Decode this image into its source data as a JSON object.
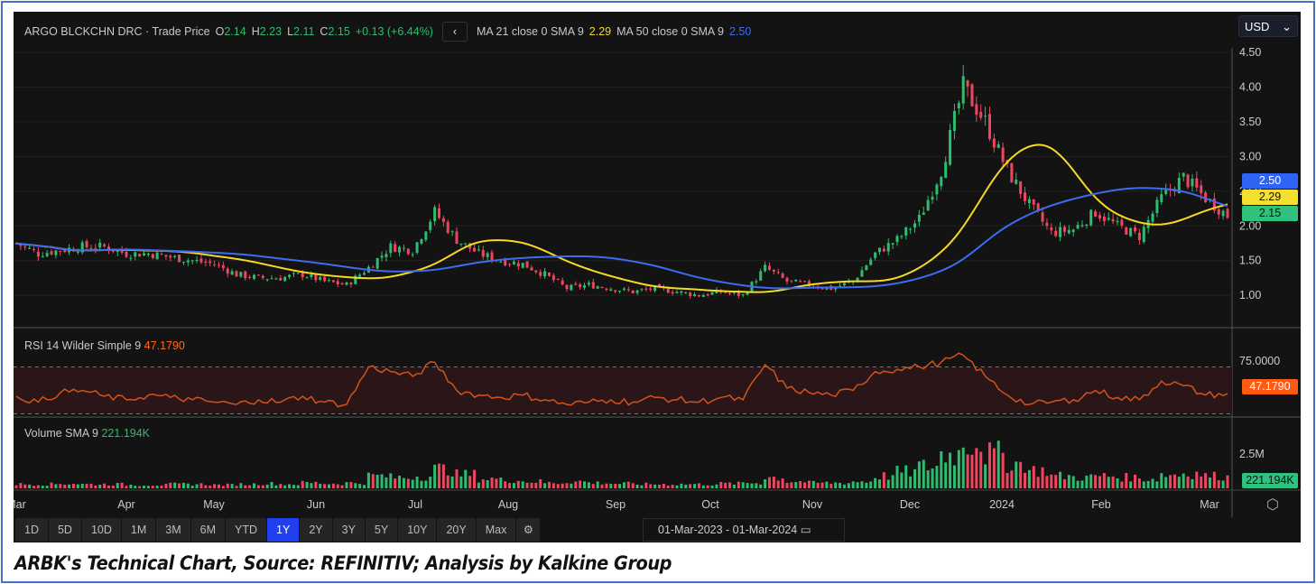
{
  "header": {
    "instrument": "ARGO BLCKCHN DRC · Trade Price",
    "o_label": "O",
    "open": "2.14",
    "h_label": "H",
    "high": "2.23",
    "l_label": "L",
    "low": "2.11",
    "c_label": "C",
    "close": "2.15",
    "change": "+0.13 (+6.44%)",
    "ma21_label": "MA 21 close 0 SMA 9",
    "ma21_value": "2.29",
    "ma50_label": "MA 50 close 0 SMA 9",
    "ma50_value": "2.50"
  },
  "currency": "USD",
  "price_axis": [
    "4.50",
    "4.00",
    "3.50",
    "3.00",
    "2.50",
    "2.00",
    "1.50",
    "1.00"
  ],
  "price_tags": {
    "ma50": "2.50",
    "ma21": "2.29",
    "close": "2.15"
  },
  "rsi": {
    "label": "RSI 14 Wilder Simple 9",
    "value": "47.1790",
    "axis": "75.0000"
  },
  "volume": {
    "label": "Volume SMA 9",
    "value": "221.194K",
    "axis": "2.5M"
  },
  "x_axis": [
    "Mar",
    "Apr",
    "May",
    "Jun",
    "Jul",
    "Aug",
    "Sep",
    "Oct",
    "Nov",
    "Dec",
    "2024",
    "Feb",
    "Mar"
  ],
  "ranges": [
    "1D",
    "5D",
    "10D",
    "1M",
    "3M",
    "6M",
    "YTD",
    "1Y",
    "2Y",
    "3Y",
    "5Y",
    "10Y",
    "20Y",
    "Max"
  ],
  "active_range": "1Y",
  "date_range": "01-Mar-2023  -  01-Mar-2024",
  "caption": "ARBK's Technical Chart, Source: REFINITIV; Analysis by Kalkine Group",
  "colors": {
    "up": "#2ebd6e",
    "down": "#f0455f",
    "ma21": "#f5d922",
    "ma50": "#3d6cf0",
    "rsi": "#d4521a"
  },
  "chart_data": {
    "type": "candlestick",
    "title": "ARGO BLCKCHN DRC - Trade Price",
    "ylim": [
      0.7,
      4.7
    ],
    "weekly_close": [
      1.75,
      1.6,
      1.65,
      1.7,
      1.7,
      1.6,
      1.6,
      1.55,
      1.5,
      1.45,
      1.3,
      1.25,
      1.25,
      1.3,
      1.2,
      1.15,
      1.4,
      1.7,
      1.65,
      2.2,
      1.8,
      1.6,
      1.5,
      1.45,
      1.3,
      1.1,
      1.15,
      1.1,
      1.05,
      1.1,
      1.05,
      1.0,
      1.05,
      1.0,
      1.4,
      1.2,
      1.15,
      1.1,
      1.2,
      1.6,
      1.8,
      2.1,
      2.8,
      4.0,
      3.5,
      2.8,
      2.3,
      1.9,
      1.95,
      2.2,
      2.0,
      1.85,
      2.4,
      2.7,
      2.4,
      2.15
    ],
    "weekly_volume_m": [
      0.3,
      0.3,
      0.35,
      0.3,
      0.3,
      0.25,
      0.25,
      0.3,
      0.3,
      0.25,
      0.3,
      0.35,
      0.3,
      0.4,
      0.35,
      0.4,
      0.9,
      0.8,
      0.9,
      1.4,
      1.0,
      0.7,
      0.6,
      0.5,
      0.4,
      0.5,
      0.4,
      0.35,
      0.3,
      0.3,
      0.3,
      0.3,
      0.35,
      0.4,
      0.8,
      0.5,
      0.4,
      0.4,
      0.5,
      0.9,
      1.2,
      1.6,
      2.5,
      3.4,
      2.5,
      1.8,
      1.3,
      0.9,
      0.8,
      0.9,
      0.8,
      0.7,
      1.0,
      1.1,
      0.9,
      0.8
    ],
    "weekly_rsi": [
      45,
      40,
      48,
      50,
      45,
      42,
      46,
      44,
      42,
      40,
      38,
      42,
      40,
      45,
      40,
      38,
      70,
      66,
      62,
      74,
      50,
      46,
      44,
      46,
      42,
      38,
      40,
      42,
      40,
      44,
      42,
      40,
      44,
      42,
      72,
      52,
      48,
      46,
      50,
      66,
      68,
      70,
      74,
      80,
      62,
      46,
      38,
      40,
      42,
      50,
      44,
      42,
      58,
      54,
      46,
      47.179
    ],
    "ma21_last": 2.29,
    "ma50_last": 2.5
  }
}
